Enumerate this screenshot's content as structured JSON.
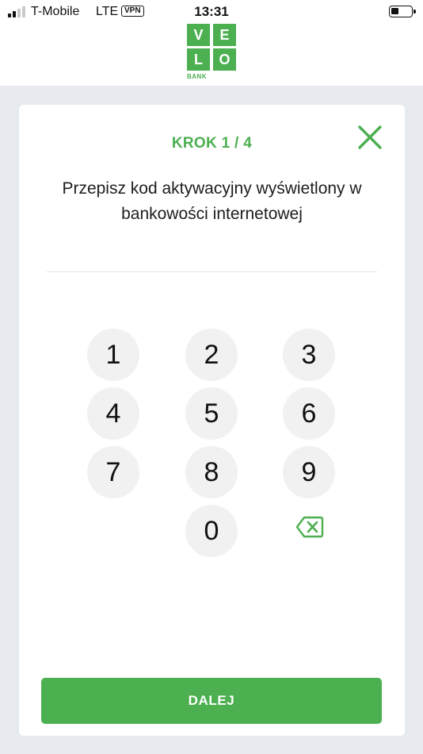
{
  "status_bar": {
    "carrier": "T-Mobile",
    "network": "LTE",
    "vpn": "VPN",
    "time": "13:31"
  },
  "logo": {
    "letters": [
      "V",
      "E",
      "L",
      "O"
    ],
    "subtitle": "BANK",
    "color": "#4caf50"
  },
  "activation": {
    "step_label": "KROK 1 / 4",
    "instruction": "Przepisz kod aktywacyjny wyświetlony w bankowości internetowej",
    "code_value": ""
  },
  "keypad": {
    "keys": [
      "1",
      "2",
      "3",
      "4",
      "5",
      "6",
      "7",
      "8",
      "9",
      "0"
    ],
    "backspace_icon": "backspace-icon"
  },
  "actions": {
    "next_label": "DALEJ"
  },
  "colors": {
    "accent": "#4caf50",
    "background": "#e7eaee",
    "key_background": "#f1f1f1"
  }
}
